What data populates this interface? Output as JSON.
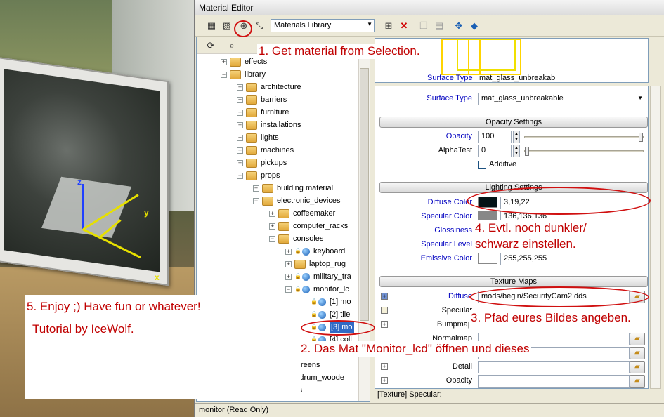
{
  "window": {
    "title": "Material Editor"
  },
  "toolbar": {
    "library_select": "Materials Library",
    "icons": [
      "add-material-icon",
      "add-submaterial-icon",
      "get-from-selection-icon",
      "pick-icon",
      "add-icon",
      "delete-icon",
      "copy-icon",
      "paste-icon",
      "assign-icon",
      "preview-icon"
    ]
  },
  "tree": {
    "items": [
      {
        "label": "effects",
        "level": 1,
        "kind": "folder",
        "exp": "+"
      },
      {
        "label": "library",
        "level": 1,
        "kind": "folder",
        "exp": "−"
      },
      {
        "label": "architecture",
        "level": 2,
        "kind": "folder",
        "exp": "+"
      },
      {
        "label": "barriers",
        "level": 2,
        "kind": "folder",
        "exp": "+"
      },
      {
        "label": "furniture",
        "level": 2,
        "kind": "folder",
        "exp": "+"
      },
      {
        "label": "installations",
        "level": 2,
        "kind": "folder",
        "exp": "+"
      },
      {
        "label": "lights",
        "level": 2,
        "kind": "folder",
        "exp": "+"
      },
      {
        "label": "machines",
        "level": 2,
        "kind": "folder",
        "exp": "+"
      },
      {
        "label": "pickups",
        "level": 2,
        "kind": "folder",
        "exp": "+"
      },
      {
        "label": "props",
        "level": 2,
        "kind": "folder",
        "exp": "−"
      },
      {
        "label": "building material",
        "level": 3,
        "kind": "folder",
        "exp": "+"
      },
      {
        "label": "electronic_devices",
        "level": 3,
        "kind": "folder",
        "exp": "−"
      },
      {
        "label": "coffeemaker",
        "level": 4,
        "kind": "folder",
        "exp": "+"
      },
      {
        "label": "computer_racks",
        "level": 4,
        "kind": "folder",
        "exp": "+"
      },
      {
        "label": "consoles",
        "level": 4,
        "kind": "folder",
        "exp": "−"
      },
      {
        "label": "keyboard",
        "level": 5,
        "kind": "mat",
        "exp": "+"
      },
      {
        "label": "laptop_rug",
        "level": 5,
        "kind": "folder",
        "exp": "+"
      },
      {
        "label": "military_tra",
        "level": 5,
        "kind": "mat",
        "exp": "+"
      },
      {
        "label": "monitor_lc",
        "level": 5,
        "kind": "mat",
        "exp": "−"
      },
      {
        "label": "[1] mo",
        "level": 6,
        "kind": "mat",
        "exp": ""
      },
      {
        "label": "[2] tile",
        "level": 6,
        "kind": "mat",
        "exp": ""
      },
      {
        "label": "[3] mo",
        "level": 6,
        "kind": "mat",
        "exp": "",
        "selected": true
      },
      {
        "label": "[4] coll",
        "level": 6,
        "kind": "mat",
        "exp": ""
      },
      {
        "label": "",
        "level": 4,
        "kind": "folder",
        "exp": "+"
      },
      {
        "label": "screens",
        "level": 4,
        "kind": "folder",
        "exp": "+"
      },
      {
        "label": "kable_drum_woode",
        "level": 3,
        "kind": "folder",
        "exp": ""
      },
      {
        "label": "ladders",
        "level": 3,
        "kind": "folder",
        "exp": ""
      }
    ]
  },
  "preview": {
    "surface_type_label": "Surface Type",
    "surface_type_value": "mat_glass_unbreakab"
  },
  "properties": {
    "surface_type_label": "Surface Type",
    "surface_type_value": "mat_glass_unbreakable",
    "opacity_section": "Opacity Settings",
    "opacity_label": "Opacity",
    "opacity_value": "100",
    "alphatest_label": "AlphaTest",
    "alphatest_value": "0",
    "additive_label": "Additive",
    "lighting_section": "Lighting Settings",
    "diffuse_color_label": "Diffuse Color",
    "diffuse_color_value": "3,19,22",
    "diffuse_color_hex": "#031316",
    "specular_color_label": "Specular Color",
    "specular_color_value": "136,136,136",
    "specular_color_hex": "#888888",
    "glossiness_label": "Glossiness",
    "specular_level_label": "Specular Level",
    "emissive_color_label": "Emissive Color",
    "emissive_color_value": "255,255,255",
    "emissive_color_hex": "#ffffff",
    "texture_section": "Texture Maps",
    "tex_diffuse_label": "Diffuse",
    "tex_diffuse_value": "mods/begin/SecurityCam2.dds",
    "tex_specular_label": "Specular",
    "tex_bumpmap_label": "Bumpmap",
    "tex_normalmap_label": "Normalmap",
    "tex_detail_label": "Detail",
    "tex_opacity_label": "Opacity"
  },
  "texture_status": "[Texture] Specular:",
  "statusbar": {
    "text": "monitor (Read Only)"
  },
  "annotations": {
    "step1": "1. Get material from Selection.",
    "step2": "2. Das Mat \"Monitor_lcd\" öffnen und dieses",
    "step3": "3. Pfad eures Bildes angeben.",
    "step4_line1": "4. Evtl. noch dunkler/",
    "step4_line2": "schwarz einstellen.",
    "step5": "5. Enjoy ;) Have fun or whatever!",
    "credit": "Tutorial by IceWolf.",
    "color": "#c00000"
  },
  "viewport": {
    "axis_x": "x",
    "axis_y": "y",
    "axis_z": "z"
  }
}
